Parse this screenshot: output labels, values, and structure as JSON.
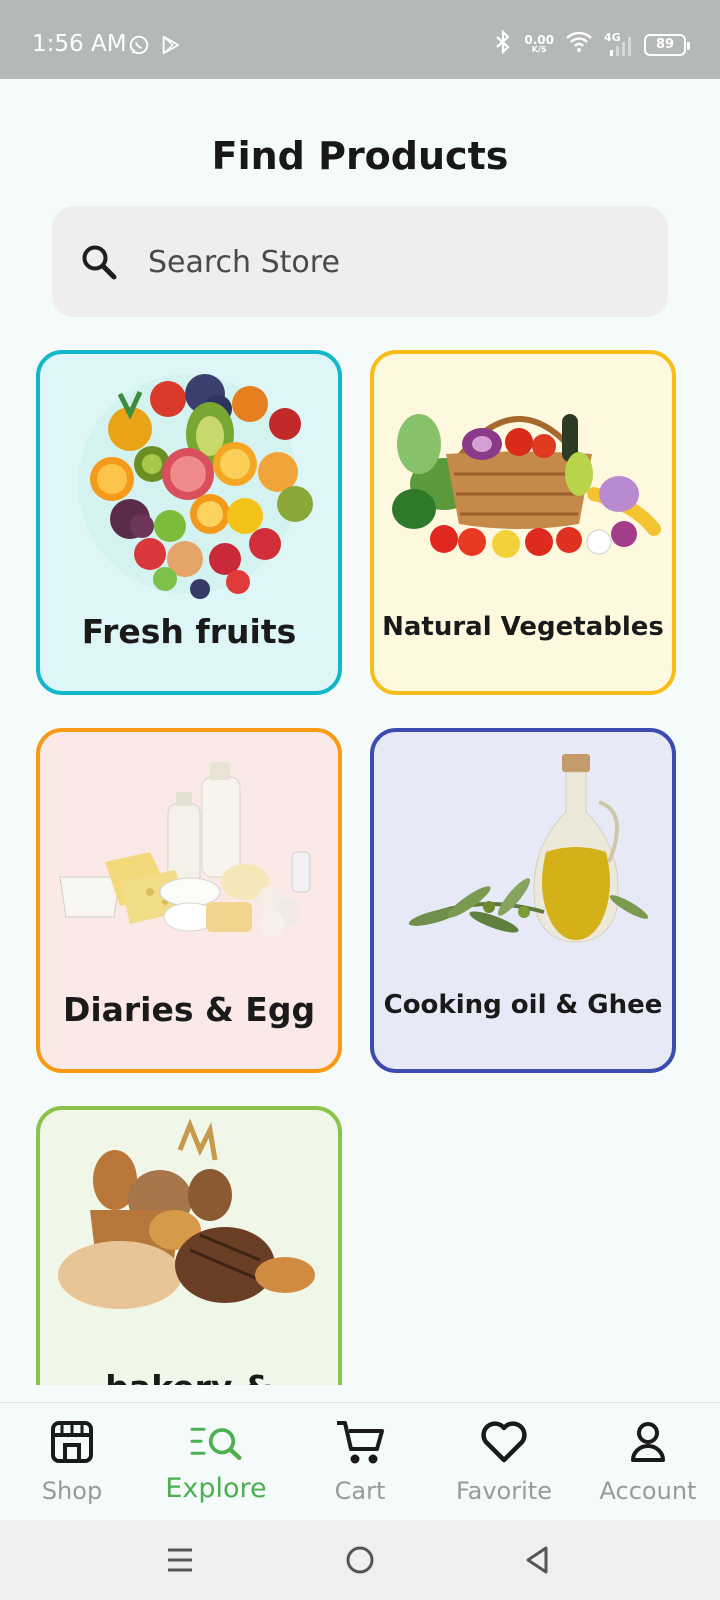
{
  "status_bar": {
    "time": "1:56 AM",
    "net_speed_value": "0.00",
    "net_speed_unit": "K/S",
    "network": "4G",
    "battery": "89",
    "icons": [
      "whatsapp-icon",
      "play-store-icon",
      "bluetooth-icon",
      "wifi-icon",
      "signal-icon",
      "battery-icon"
    ]
  },
  "header": {
    "title": "Find Products"
  },
  "search": {
    "placeholder": "Search Store",
    "icon": "search-icon"
  },
  "categories": [
    {
      "label": "Fresh fruits",
      "border_color": "#13b7cc",
      "bg_color": "#def6f8",
      "image": "fruits-image"
    },
    {
      "label": "Natural Vegetables",
      "border_color": "#f8bd16",
      "bg_color": "#fef8df",
      "image": "vegetables-basket-image"
    },
    {
      "label": "Diaries & Egg",
      "border_color": "#f89a14",
      "bg_color": "#fbe9e7",
      "image": "dairy-eggs-image"
    },
    {
      "label": "Cooking oil & Ghee",
      "border_color": "#3c4bb0",
      "bg_color": "#e8e9f7",
      "image": "olive-oil-image"
    },
    {
      "label": "bakery & Snacks",
      "border_color": "#8bc34a",
      "bg_color": "#f1f7e8",
      "image": "bread-image"
    }
  ],
  "bottom_nav": {
    "active_color": "#4caf50",
    "inactive_color": "#9a9a9a",
    "items": [
      {
        "label": "Shop",
        "icon": "store-icon",
        "active": false
      },
      {
        "label": "Explore",
        "icon": "explore-icon",
        "active": true
      },
      {
        "label": "Cart",
        "icon": "cart-icon",
        "active": false
      },
      {
        "label": "Favorite",
        "icon": "heart-icon",
        "active": false
      },
      {
        "label": "Account",
        "icon": "person-icon",
        "active": false
      }
    ]
  },
  "system_nav": {
    "icons": [
      "menu-icon",
      "home-icon",
      "back-icon"
    ]
  }
}
